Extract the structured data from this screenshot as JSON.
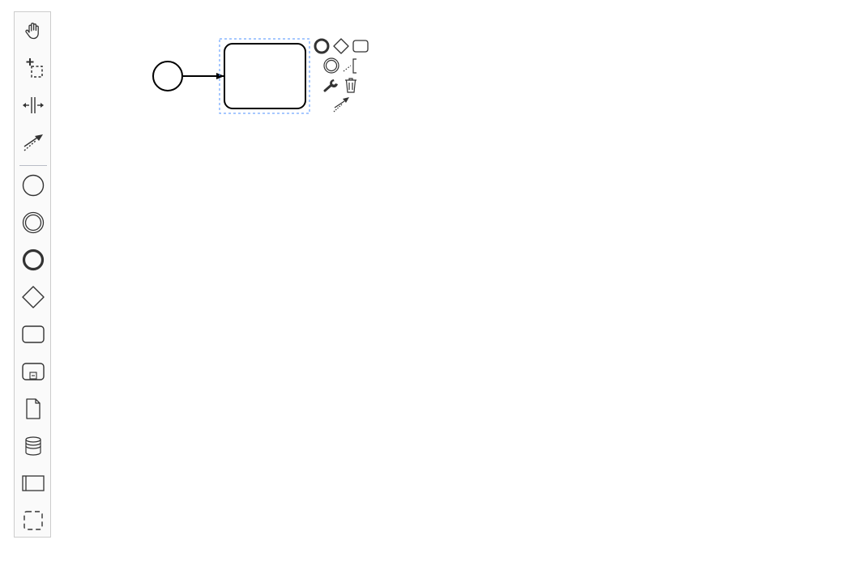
{
  "palette": {
    "tools": [
      {
        "name": "hand-tool",
        "icon": "hand-icon"
      },
      {
        "name": "lasso-tool",
        "icon": "lasso-icon"
      },
      {
        "name": "space-tool",
        "icon": "space-icon"
      },
      {
        "name": "global-connect-tool",
        "icon": "connection-icon"
      },
      {
        "name": "create-start-event",
        "icon": "start-event-icon"
      },
      {
        "name": "create-intermediate-event",
        "icon": "intermediate-event-icon"
      },
      {
        "name": "create-end-event",
        "icon": "end-event-icon"
      },
      {
        "name": "create-exclusive-gateway",
        "icon": "gateway-icon"
      },
      {
        "name": "create-task",
        "icon": "task-icon"
      },
      {
        "name": "create-subprocess",
        "icon": "subprocess-icon"
      },
      {
        "name": "create-data-object",
        "icon": "data-object-icon"
      },
      {
        "name": "create-data-store",
        "icon": "data-store-icon"
      },
      {
        "name": "create-participant",
        "icon": "participant-icon"
      },
      {
        "name": "create-group",
        "icon": "group-icon"
      }
    ]
  },
  "diagram": {
    "elements": [
      {
        "type": "start-event",
        "selected": false
      },
      {
        "type": "sequence-flow",
        "selected": false
      },
      {
        "type": "task",
        "selected": true
      }
    ]
  },
  "context_pad": {
    "entries": [
      {
        "name": "append-end-event",
        "icon": "end-event-icon"
      },
      {
        "name": "append-gateway",
        "icon": "gateway-icon"
      },
      {
        "name": "append-task",
        "icon": "task-icon"
      },
      {
        "name": "append-intermediate-event",
        "icon": "intermediate-event-icon"
      },
      {
        "name": "append-text-annotation",
        "icon": "text-annotation-icon"
      },
      {
        "name": "replace",
        "icon": "wrench-icon"
      },
      {
        "name": "delete",
        "icon": "trash-icon"
      },
      {
        "name": "connect",
        "icon": "connection-icon"
      }
    ]
  },
  "colors": {
    "selection_outline": "#4d90ff",
    "palette_background": "#fafafa",
    "palette_border": "#cccccc",
    "icon": "#333333",
    "shape_stroke": "#000000"
  }
}
